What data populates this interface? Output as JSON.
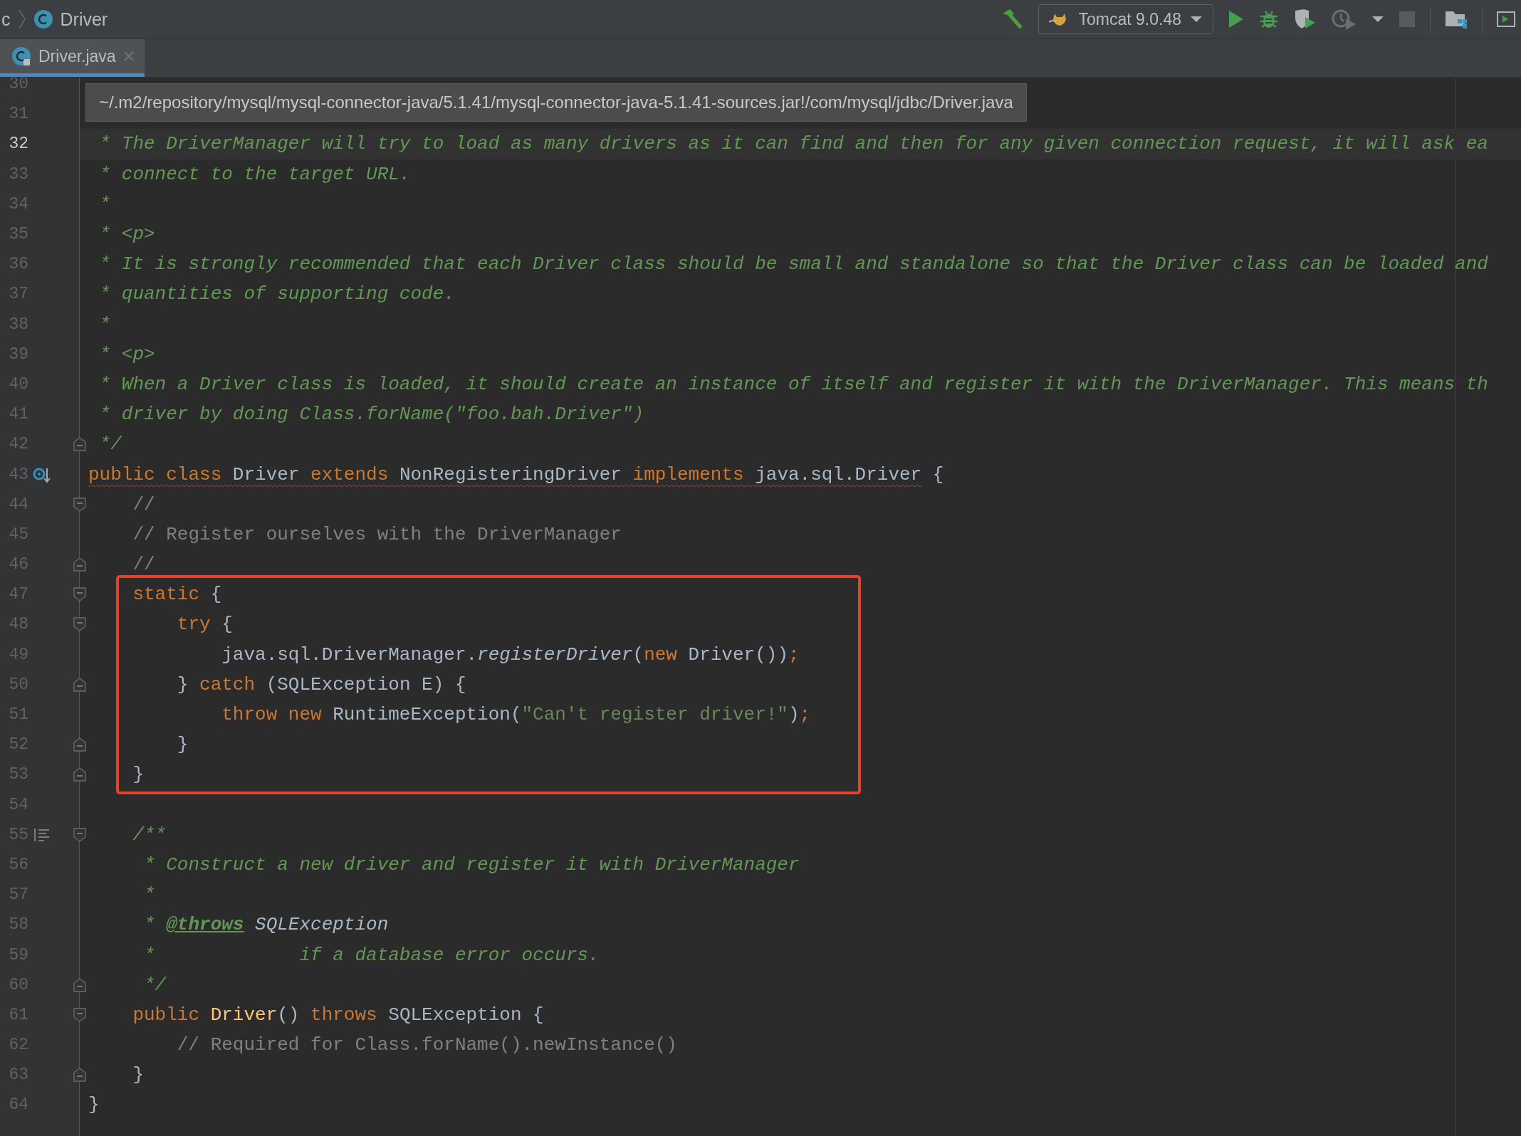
{
  "breadcrumb": [
    {
      "kind": "package",
      "label": "c"
    },
    {
      "kind": "class",
      "label": "Driver"
    }
  ],
  "toolbar": {
    "run_config": "Tomcat 9.0.48"
  },
  "tabs": [
    {
      "label": "Driver.java",
      "selected": true
    }
  ],
  "path_tooltip": "~/.m2/repository/mysql/mysql-connector-java/5.1.41/mysql-connector-java-5.1.41-sources.jar!/com/mysql/jdbc/Driver.java",
  "lines": [
    {
      "number": "30"
    },
    {
      "number": "31"
    },
    {
      "number": "32",
      "current": true,
      "tokens": [
        {
          "kind": "doc",
          "text": " * The DriverManager will try to load as many drivers as it can find and then for any given connection request, it will ask ea"
        }
      ]
    },
    {
      "number": "33",
      "tokens": [
        {
          "kind": "doc",
          "text": " * connect to the target URL."
        }
      ]
    },
    {
      "number": "34",
      "tokens": [
        {
          "kind": "doc",
          "text": " *"
        }
      ]
    },
    {
      "number": "35",
      "tokens": [
        {
          "kind": "doc",
          "text": " * <p>"
        }
      ]
    },
    {
      "number": "36",
      "tokens": [
        {
          "kind": "doc",
          "text": " * It is strongly recommended that each Driver class should be small and standalone so that the Driver class can be loaded and"
        }
      ]
    },
    {
      "number": "37",
      "tokens": [
        {
          "kind": "doc",
          "text": " * quantities of supporting code."
        }
      ]
    },
    {
      "number": "38",
      "tokens": [
        {
          "kind": "doc",
          "text": " *"
        }
      ]
    },
    {
      "number": "39",
      "tokens": [
        {
          "kind": "doc",
          "text": " * <p>"
        }
      ]
    },
    {
      "number": "40",
      "tokens": [
        {
          "kind": "doc",
          "text": " * When a Driver class is loaded, it should create an instance of itself and register it with the DriverManager. This means th"
        }
      ]
    },
    {
      "number": "41",
      "tokens": [
        {
          "kind": "doc",
          "text": " * driver by doing Class.forName(\"foo.bah.Driver\")"
        }
      ]
    },
    {
      "number": "42",
      "fold_end": true,
      "tokens": [
        {
          "kind": "doc",
          "text": " */"
        }
      ]
    },
    {
      "number": "43",
      "override_marker": true,
      "tokens": [
        {
          "kind": "keyword",
          "text": "public class",
          "error": true
        },
        {
          "kind": "plain",
          "text": " Driver ",
          "error": true
        },
        {
          "kind": "keyword",
          "text": "extends",
          "error": true
        },
        {
          "kind": "plain",
          "text": " NonRegisteringDriver ",
          "error": true
        },
        {
          "kind": "keyword",
          "text": "implements",
          "error": true
        },
        {
          "kind": "plain",
          "text": " java.sql.Driver",
          "error": true
        },
        {
          "kind": "plain",
          "text": " {"
        }
      ]
    },
    {
      "number": "44",
      "fold_start": true,
      "tokens": [
        {
          "kind": "comment",
          "text": "    //"
        }
      ]
    },
    {
      "number": "45",
      "tokens": [
        {
          "kind": "comment",
          "text": "    // Register ourselves with the DriverManager"
        }
      ]
    },
    {
      "number": "46",
      "fold_end": true,
      "tokens": [
        {
          "kind": "comment",
          "text": "    //"
        }
      ]
    },
    {
      "number": "47",
      "fold_start": true,
      "boxed": true,
      "tokens": [
        {
          "kind": "keyword",
          "text": "    static"
        },
        {
          "kind": "plain",
          "text": " {"
        }
      ]
    },
    {
      "number": "48",
      "fold_start": true,
      "boxed": true,
      "tokens": [
        {
          "kind": "keyword",
          "text": "        try"
        },
        {
          "kind": "plain",
          "text": " {"
        }
      ]
    },
    {
      "number": "49",
      "boxed": true,
      "tokens": [
        {
          "kind": "plain",
          "text": "            java.sql.DriverManager."
        },
        {
          "kind": "call",
          "text": "registerDriver"
        },
        {
          "kind": "plain",
          "text": "("
        },
        {
          "kind": "keyword",
          "text": "new"
        },
        {
          "kind": "plain",
          "text": " Driver())"
        },
        {
          "kind": "keyword",
          "text": ";"
        }
      ]
    },
    {
      "number": "50",
      "fold_end": true,
      "boxed": true,
      "tokens": [
        {
          "kind": "plain",
          "text": "        } "
        },
        {
          "kind": "keyword",
          "text": "catch"
        },
        {
          "kind": "plain",
          "text": " (SQLException E) {"
        }
      ]
    },
    {
      "number": "51",
      "boxed": true,
      "tokens": [
        {
          "kind": "keyword",
          "text": "            throw new"
        },
        {
          "kind": "plain",
          "text": " RuntimeException("
        },
        {
          "kind": "string",
          "text": "\"Can't register driver!\""
        },
        {
          "kind": "plain",
          "text": ")"
        },
        {
          "kind": "keyword",
          "text": ";"
        }
      ]
    },
    {
      "number": "52",
      "fold_end": true,
      "boxed": true,
      "tokens": [
        {
          "kind": "plain",
          "text": "        }"
        }
      ]
    },
    {
      "number": "53",
      "fold_end": true,
      "boxed": true,
      "tokens": [
        {
          "kind": "plain",
          "text": "    }"
        }
      ]
    },
    {
      "number": "54"
    },
    {
      "number": "55",
      "fold_start": true,
      "doc_marker": true,
      "tokens": [
        {
          "kind": "doc",
          "text": "    /**"
        }
      ]
    },
    {
      "number": "56",
      "tokens": [
        {
          "kind": "doc",
          "text": "     * Construct a new driver and register it with DriverManager"
        }
      ]
    },
    {
      "number": "57",
      "tokens": [
        {
          "kind": "doc",
          "text": "     *"
        }
      ]
    },
    {
      "number": "58",
      "tokens": [
        {
          "kind": "doc",
          "text": "     * "
        },
        {
          "kind": "doc-tag",
          "text": "@throws"
        },
        {
          "kind": "doc-ref",
          "text": " SQLException"
        }
      ]
    },
    {
      "number": "59",
      "tokens": [
        {
          "kind": "doc",
          "text": "     *             if a database error occurs."
        }
      ]
    },
    {
      "number": "60",
      "fold_end": true,
      "tokens": [
        {
          "kind": "doc",
          "text": "     */"
        }
      ]
    },
    {
      "number": "61",
      "fold_start": true,
      "tokens": [
        {
          "kind": "keyword",
          "text": "    public"
        },
        {
          "kind": "decl",
          "text": " Driver"
        },
        {
          "kind": "plain",
          "text": "() "
        },
        {
          "kind": "keyword",
          "text": "throws"
        },
        {
          "kind": "plain",
          "text": " SQLException {"
        }
      ]
    },
    {
      "number": "62",
      "tokens": [
        {
          "kind": "comment",
          "text": "        // Required for Class.forName().newInstance()"
        }
      ]
    },
    {
      "number": "63",
      "fold_end": true,
      "tokens": [
        {
          "kind": "plain",
          "text": "    }"
        }
      ]
    },
    {
      "number": "64",
      "tokens": [
        {
          "kind": "plain",
          "text": "}"
        }
      ]
    }
  ]
}
